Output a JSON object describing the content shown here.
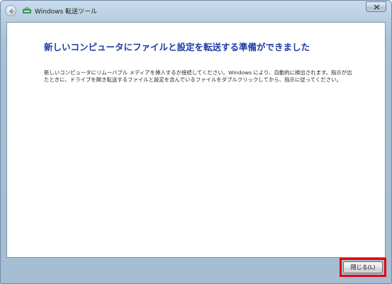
{
  "window": {
    "title": "Windows 転送ツール"
  },
  "main": {
    "heading": "新しいコンピュータにファイルと設定を転送する準備ができました",
    "body": "新しいコンピュータにリムーバブル メディアを挿入するか接続してください。Windows により、自動的に検出されます。指示が出たときに、ドライブを開き転送するファイルと設定を含んでいるファイルをダブルクリックしてから、指示に従ってください。"
  },
  "footer": {
    "close_label": "閉じる(L)"
  },
  "colors": {
    "heading": "#1e3aa6",
    "highlight_border": "#e6000e"
  },
  "icons": {
    "back": "back-arrow-icon",
    "app": "transfer-icon",
    "window_close": "close-icon"
  }
}
